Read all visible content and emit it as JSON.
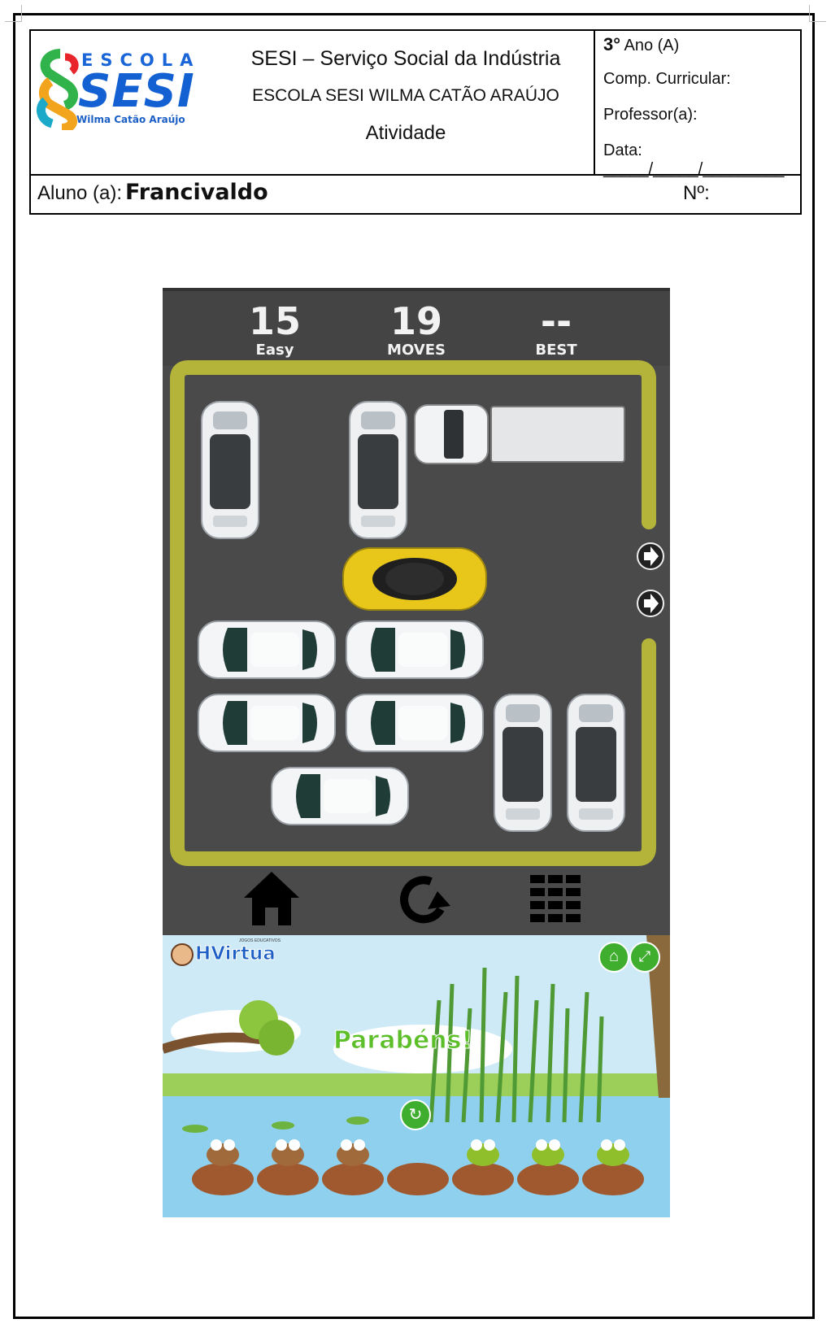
{
  "header": {
    "logo": {
      "word_top": "ESCOLA",
      "word_main": "SESI",
      "word_sub": "Wilma Catão Araújo"
    },
    "org_line": "SESI – Serviço Social da Indústria",
    "school_line": "ESCOLA SESI WILMA CATÃO ARAÚJO",
    "activity_line": "Atividade",
    "grade_number": "3°",
    "grade_rest": "Ano (A)",
    "curricular_label": "Comp. Curricular:",
    "teacher_label": "Professor(a):",
    "date_label": "Data: _____/_____/_________",
    "student_label": "Aluno (a):",
    "student_name": "Francivaldo",
    "number_label": "Nº:"
  },
  "parking_game": {
    "level_value": "15",
    "level_label": "Easy",
    "moves_value": "19",
    "moves_label": "MOVES",
    "best_value": "--",
    "best_label": "BEST",
    "icons": [
      "home-icon",
      "restart-icon",
      "level-grid-icon",
      "exit-arrow-icon"
    ],
    "colors": {
      "asphalt": "#4a4a4a",
      "lane": "#b5b43a",
      "target_car": "#e8c61a",
      "car": "#f4f5f6"
    }
  },
  "frog_game": {
    "brand": "HVirtua",
    "brand_tag": "JOGOS EDUCATIVOS",
    "message": "Parabéns!",
    "icons": [
      "home-icon",
      "fullscreen-icon",
      "replay-icon"
    ],
    "colors": {
      "message": "#5cbf2a",
      "button": "#3fae2f",
      "water": "#8fd0ee"
    }
  }
}
